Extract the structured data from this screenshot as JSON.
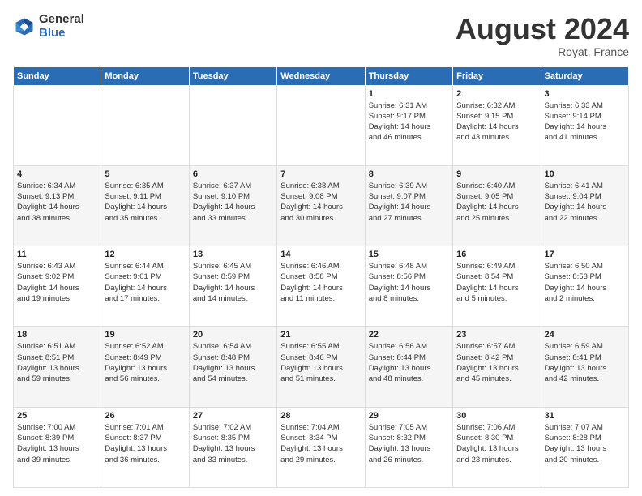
{
  "logo": {
    "general": "General",
    "blue": "Blue"
  },
  "title": "August 2024",
  "location": "Royat, France",
  "days_of_week": [
    "Sunday",
    "Monday",
    "Tuesday",
    "Wednesday",
    "Thursday",
    "Friday",
    "Saturday"
  ],
  "weeks": [
    [
      {
        "day": "",
        "info": ""
      },
      {
        "day": "",
        "info": ""
      },
      {
        "day": "",
        "info": ""
      },
      {
        "day": "",
        "info": ""
      },
      {
        "day": "1",
        "info": "Sunrise: 6:31 AM\nSunset: 9:17 PM\nDaylight: 14 hours\nand 46 minutes."
      },
      {
        "day": "2",
        "info": "Sunrise: 6:32 AM\nSunset: 9:15 PM\nDaylight: 14 hours\nand 43 minutes."
      },
      {
        "day": "3",
        "info": "Sunrise: 6:33 AM\nSunset: 9:14 PM\nDaylight: 14 hours\nand 41 minutes."
      }
    ],
    [
      {
        "day": "4",
        "info": "Sunrise: 6:34 AM\nSunset: 9:13 PM\nDaylight: 14 hours\nand 38 minutes."
      },
      {
        "day": "5",
        "info": "Sunrise: 6:35 AM\nSunset: 9:11 PM\nDaylight: 14 hours\nand 35 minutes."
      },
      {
        "day": "6",
        "info": "Sunrise: 6:37 AM\nSunset: 9:10 PM\nDaylight: 14 hours\nand 33 minutes."
      },
      {
        "day": "7",
        "info": "Sunrise: 6:38 AM\nSunset: 9:08 PM\nDaylight: 14 hours\nand 30 minutes."
      },
      {
        "day": "8",
        "info": "Sunrise: 6:39 AM\nSunset: 9:07 PM\nDaylight: 14 hours\nand 27 minutes."
      },
      {
        "day": "9",
        "info": "Sunrise: 6:40 AM\nSunset: 9:05 PM\nDaylight: 14 hours\nand 25 minutes."
      },
      {
        "day": "10",
        "info": "Sunrise: 6:41 AM\nSunset: 9:04 PM\nDaylight: 14 hours\nand 22 minutes."
      }
    ],
    [
      {
        "day": "11",
        "info": "Sunrise: 6:43 AM\nSunset: 9:02 PM\nDaylight: 14 hours\nand 19 minutes."
      },
      {
        "day": "12",
        "info": "Sunrise: 6:44 AM\nSunset: 9:01 PM\nDaylight: 14 hours\nand 17 minutes."
      },
      {
        "day": "13",
        "info": "Sunrise: 6:45 AM\nSunset: 8:59 PM\nDaylight: 14 hours\nand 14 minutes."
      },
      {
        "day": "14",
        "info": "Sunrise: 6:46 AM\nSunset: 8:58 PM\nDaylight: 14 hours\nand 11 minutes."
      },
      {
        "day": "15",
        "info": "Sunrise: 6:48 AM\nSunset: 8:56 PM\nDaylight: 14 hours\nand 8 minutes."
      },
      {
        "day": "16",
        "info": "Sunrise: 6:49 AM\nSunset: 8:54 PM\nDaylight: 14 hours\nand 5 minutes."
      },
      {
        "day": "17",
        "info": "Sunrise: 6:50 AM\nSunset: 8:53 PM\nDaylight: 14 hours\nand 2 minutes."
      }
    ],
    [
      {
        "day": "18",
        "info": "Sunrise: 6:51 AM\nSunset: 8:51 PM\nDaylight: 13 hours\nand 59 minutes."
      },
      {
        "day": "19",
        "info": "Sunrise: 6:52 AM\nSunset: 8:49 PM\nDaylight: 13 hours\nand 56 minutes."
      },
      {
        "day": "20",
        "info": "Sunrise: 6:54 AM\nSunset: 8:48 PM\nDaylight: 13 hours\nand 54 minutes."
      },
      {
        "day": "21",
        "info": "Sunrise: 6:55 AM\nSunset: 8:46 PM\nDaylight: 13 hours\nand 51 minutes."
      },
      {
        "day": "22",
        "info": "Sunrise: 6:56 AM\nSunset: 8:44 PM\nDaylight: 13 hours\nand 48 minutes."
      },
      {
        "day": "23",
        "info": "Sunrise: 6:57 AM\nSunset: 8:42 PM\nDaylight: 13 hours\nand 45 minutes."
      },
      {
        "day": "24",
        "info": "Sunrise: 6:59 AM\nSunset: 8:41 PM\nDaylight: 13 hours\nand 42 minutes."
      }
    ],
    [
      {
        "day": "25",
        "info": "Sunrise: 7:00 AM\nSunset: 8:39 PM\nDaylight: 13 hours\nand 39 minutes."
      },
      {
        "day": "26",
        "info": "Sunrise: 7:01 AM\nSunset: 8:37 PM\nDaylight: 13 hours\nand 36 minutes."
      },
      {
        "day": "27",
        "info": "Sunrise: 7:02 AM\nSunset: 8:35 PM\nDaylight: 13 hours\nand 33 minutes."
      },
      {
        "day": "28",
        "info": "Sunrise: 7:04 AM\nSunset: 8:34 PM\nDaylight: 13 hours\nand 29 minutes."
      },
      {
        "day": "29",
        "info": "Sunrise: 7:05 AM\nSunset: 8:32 PM\nDaylight: 13 hours\nand 26 minutes."
      },
      {
        "day": "30",
        "info": "Sunrise: 7:06 AM\nSunset: 8:30 PM\nDaylight: 13 hours\nand 23 minutes."
      },
      {
        "day": "31",
        "info": "Sunrise: 7:07 AM\nSunset: 8:28 PM\nDaylight: 13 hours\nand 20 minutes."
      }
    ]
  ]
}
